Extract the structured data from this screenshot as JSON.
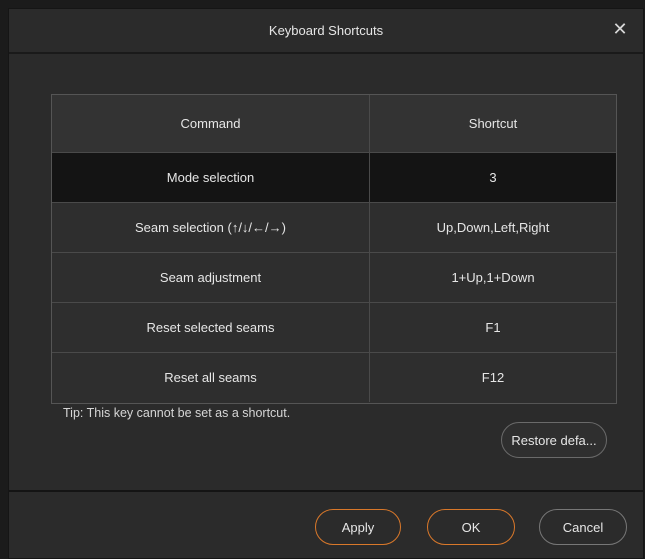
{
  "dialog": {
    "title": "Keyboard Shortcuts",
    "close_glyph": "✕"
  },
  "table": {
    "headers": {
      "command": "Command",
      "shortcut": "Shortcut"
    },
    "rows": [
      {
        "command": "Mode selection",
        "shortcut": "3",
        "selected": true
      },
      {
        "command": "Seam selection (↑/↓/←/→)",
        "shortcut": "Up,Down,Left,Right",
        "selected": false
      },
      {
        "command": "Seam adjustment",
        "shortcut": "1+Up,1+Down",
        "selected": false
      },
      {
        "command": "Reset selected seams",
        "shortcut": "F1",
        "selected": false
      },
      {
        "command": "Reset all seams",
        "shortcut": "F12",
        "selected": false
      }
    ]
  },
  "tip": "Tip: This key cannot be set as a shortcut.",
  "buttons": {
    "restore": "Restore defa...",
    "apply": "Apply",
    "ok": "OK",
    "cancel": "Cancel"
  },
  "colors": {
    "accent": "#d9782a",
    "background": "#2b2b2b",
    "selected_row": "#141414"
  }
}
